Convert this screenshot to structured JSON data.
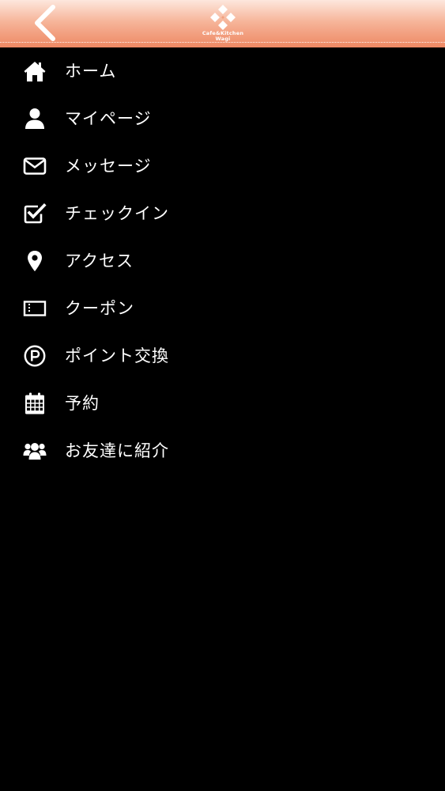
{
  "header": {
    "back_icon": "chevron-left-icon",
    "logo": {
      "icon": "diamond-logo-icon",
      "line1": "Cafe&Kitchen",
      "line2": "Wagi"
    }
  },
  "menu": {
    "items": [
      {
        "label": "ホーム",
        "icon": "home-icon"
      },
      {
        "label": "マイページ",
        "icon": "user-icon"
      },
      {
        "label": "メッセージ",
        "icon": "envelope-icon"
      },
      {
        "label": "チェックイン",
        "icon": "check-square-icon"
      },
      {
        "label": "アクセス",
        "icon": "map-marker-icon"
      },
      {
        "label": "クーポン",
        "icon": "ticket-icon"
      },
      {
        "label": "ポイント交換",
        "icon": "point-icon"
      },
      {
        "label": "予約",
        "icon": "calendar-icon"
      },
      {
        "label": "お友達に紹介",
        "icon": "users-icon"
      }
    ]
  },
  "colors": {
    "background": "#000000",
    "header_top": "#fde7dd",
    "header_bottom": "#ee8863",
    "text": "#ffffff"
  }
}
